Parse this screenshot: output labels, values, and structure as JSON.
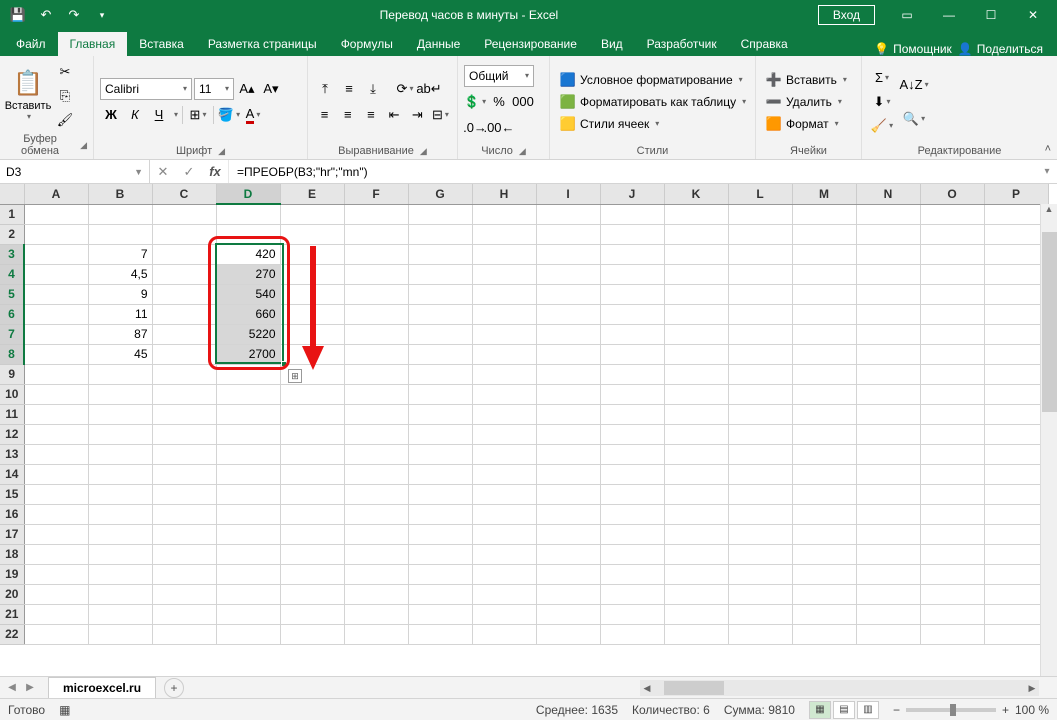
{
  "titlebar": {
    "title": "Перевод часов в минуты  -  Excel",
    "login": "Вход"
  },
  "tabs": {
    "file": "Файл",
    "home": "Главная",
    "insert": "Вставка",
    "layout": "Разметка страницы",
    "formulas": "Формулы",
    "data": "Данные",
    "review": "Рецензирование",
    "view": "Вид",
    "developer": "Разработчик",
    "help": "Справка",
    "tellme": "Помощник",
    "share": "Поделиться"
  },
  "ribbon": {
    "clipboard": {
      "label": "Буфер обмена",
      "paste": "Вставить"
    },
    "font": {
      "label": "Шрифт",
      "name": "Calibri",
      "size": "11"
    },
    "alignment": {
      "label": "Выравнивание"
    },
    "number": {
      "label": "Число",
      "format": "Общий"
    },
    "styles": {
      "label": "Стили",
      "conditional": "Условное форматирование",
      "table": "Форматировать как таблицу",
      "cell": "Стили ячеек"
    },
    "cells": {
      "label": "Ячейки",
      "insert": "Вставить",
      "delete": "Удалить",
      "format": "Формат"
    },
    "editing": {
      "label": "Редактирование"
    }
  },
  "namebox": "D3",
  "formula": "=ПРЕОБР(B3;\"hr\";\"mn\")",
  "columns": [
    "A",
    "B",
    "C",
    "D",
    "E",
    "F",
    "G",
    "H",
    "I",
    "J",
    "K",
    "L",
    "M",
    "N",
    "O",
    "P"
  ],
  "rows": [
    "1",
    "2",
    "3",
    "4",
    "5",
    "6",
    "7",
    "8",
    "9",
    "10",
    "11",
    "12",
    "13",
    "14",
    "15",
    "16",
    "17",
    "18",
    "19",
    "20",
    "21",
    "22"
  ],
  "data_b": {
    "3": "7",
    "4": "4,5",
    "5": "9",
    "6": "11",
    "7": "87",
    "8": "45"
  },
  "data_d": {
    "3": "420",
    "4": "270",
    "5": "540",
    "6": "660",
    "7": "5220",
    "8": "2700"
  },
  "selected_col": "D",
  "selected_rows": [
    "3",
    "4",
    "5",
    "6",
    "7",
    "8"
  ],
  "sheet": {
    "name": "microexcel.ru"
  },
  "status": {
    "ready": "Готово",
    "avg_label": "Среднее:",
    "avg": "1635",
    "count_label": "Количество:",
    "count": "6",
    "sum_label": "Сумма:",
    "sum": "9810",
    "zoom": "100 %"
  }
}
